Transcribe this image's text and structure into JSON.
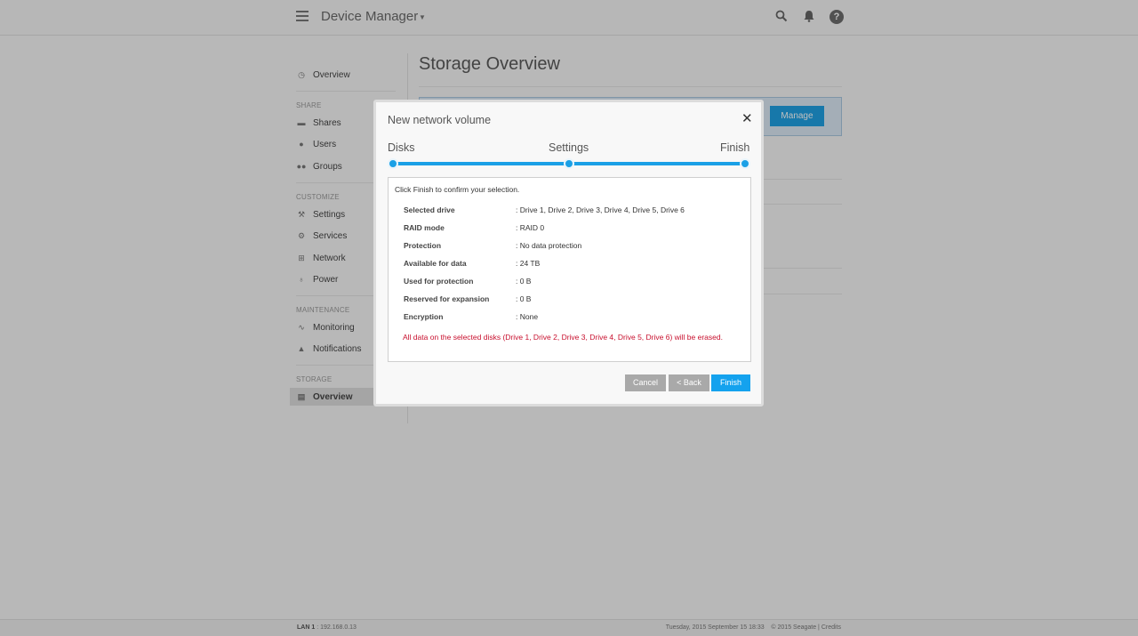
{
  "header": {
    "app_title": "Device Manager",
    "icons": [
      "search-icon",
      "bell-icon",
      "help-icon"
    ]
  },
  "sidebar": {
    "overview_label": "Overview",
    "sections": [
      {
        "heading": "SHARE",
        "items": [
          "Shares",
          "Users",
          "Groups"
        ]
      },
      {
        "heading": "CUSTOMIZE",
        "items": [
          "Settings",
          "Services",
          "Network",
          "Power"
        ]
      },
      {
        "heading": "MAINTENANCE",
        "items": [
          "Monitoring",
          "Notifications"
        ]
      },
      {
        "heading": "STORAGE",
        "items": [
          "Overview"
        ]
      }
    ]
  },
  "main": {
    "page_title": "Storage Overview",
    "manage_label": "Manage"
  },
  "modal": {
    "title": "New network volume",
    "steps": [
      "Disks",
      "Settings",
      "Finish"
    ],
    "intro": "Click Finish to confirm your selection.",
    "rows": [
      {
        "label": "Selected drive",
        "value": ": Drive 1, Drive 2, Drive 3, Drive 4, Drive 5, Drive 6"
      },
      {
        "label": "RAID mode",
        "value": ": RAID 0"
      },
      {
        "label": "Protection",
        "value": ": No data protection"
      },
      {
        "label": "Available for data",
        "value": ": 24 TB"
      },
      {
        "label": "Used for protection",
        "value": ": 0 B"
      },
      {
        "label": "Reserved for expansion",
        "value": ": 0 B"
      },
      {
        "label": "Encryption",
        "value": ": None"
      }
    ],
    "warning": "All data on the selected disks (Drive 1, Drive 2, Drive 3, Drive 4, Drive 5, Drive 6) will be erased.",
    "buttons": {
      "cancel": "Cancel",
      "back": "< Back",
      "finish": "Finish"
    }
  },
  "footer": {
    "lan_label": "LAN 1",
    "lan_value": ": 192.168.0.13",
    "datetime": "Tuesday, 2015 September 15   18:33",
    "copyright": "© 2015 Seagate | Credits"
  },
  "colors": {
    "accent": "#14a2ee",
    "warning": "#c8102e",
    "button_gray": "#a9a9a9"
  }
}
